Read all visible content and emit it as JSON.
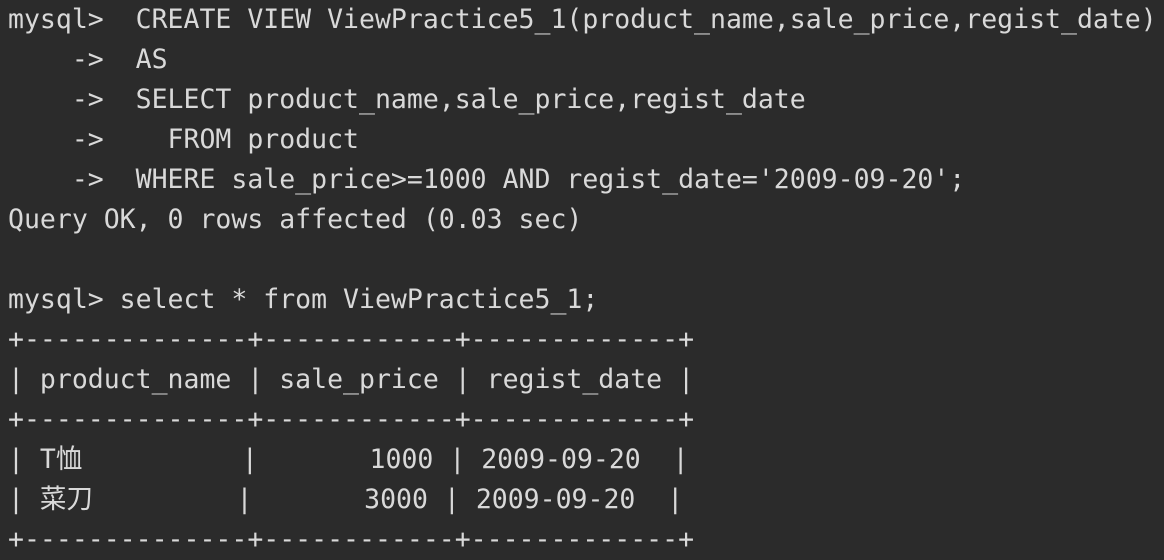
{
  "terminal": {
    "lines": [
      "mysql>  CREATE VIEW ViewPractice5_1(product_name,sale_price,regist_date)",
      "    ->  AS",
      "    ->  SELECT product_name,sale_price,regist_date",
      "    ->    FROM product",
      "    ->  WHERE sale_price>=1000 AND regist_date='2009-09-20';",
      "Query OK, 0 rows affected (0.03 sec)",
      "",
      "mysql> select * from ViewPractice5_1;",
      "+--------------+------------+-------------+",
      "| product_name | sale_price | regist_date |",
      "+--------------+------------+-------------+",
      "| T恤          |       1000 | 2009-09-20  |",
      "| 菜刀         |       3000 | 2009-09-20  |",
      "+--------------+------------+-------------+"
    ]
  }
}
